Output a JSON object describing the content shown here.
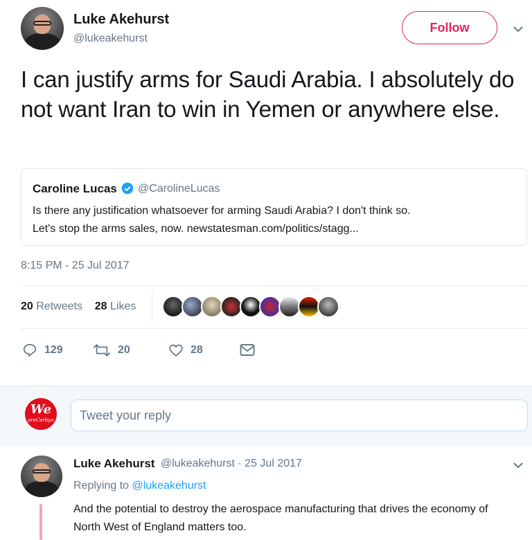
{
  "tweet": {
    "author_name": "Luke Akehurst",
    "author_handle": "@lukeakehurst",
    "follow_label": "Follow",
    "text": "I can justify arms for Saudi Arabia. I absolutely do not want Iran to win in Yemen or anywhere else.",
    "timestamp": "8:15 PM - 25 Jul 2017",
    "quote": {
      "name": "Caroline Lucas",
      "handle": "@CarolineLucas",
      "text_line1": "Is there any justification whatsoever for arming Saudi Arabia? I don't think so.",
      "text_line2": "Let's stop the arms sales, now. newstatesman.com/politics/stagg..."
    },
    "retweets_count": "20",
    "retweets_label": "Retweets",
    "likes_count": "28",
    "likes_label": "Likes",
    "actions": {
      "reply_count": "129",
      "retweet_count": "20",
      "like_count": "28"
    }
  },
  "reply_box": {
    "avatar_text": "We",
    "avatar_subtext": "areCorbyn",
    "placeholder": "Tweet your reply"
  },
  "reply": {
    "author_name": "Luke Akehurst",
    "author_handle": "@lukeakehurst · 25 Jul 2017",
    "replying_prefix": "Replying to",
    "replying_to": "@lukeakehurst",
    "text": "And the potential to destroy the aerospace manufacturing that drives the economy of North West of England matters too."
  },
  "colors": {
    "accent_pink": "#e0245e",
    "link_blue": "#1da1f2",
    "muted_gray": "#657786",
    "verified_blue": "#1da1f2"
  },
  "icons": [
    "chevron-down-icon",
    "verified-icon",
    "reply-icon",
    "retweet-icon",
    "heart-icon",
    "direct-message-icon"
  ]
}
